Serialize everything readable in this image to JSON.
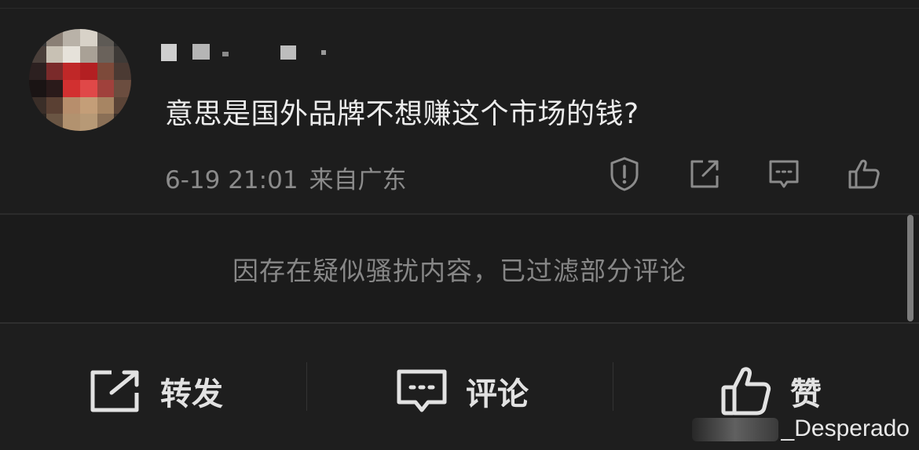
{
  "comment": {
    "text": "意思是国外品牌不想赚这个市场的钱?",
    "date": "6-19 21:01",
    "location": "来自广东"
  },
  "comment_actions": [
    {
      "icon": "report-icon"
    },
    {
      "icon": "share-icon"
    },
    {
      "icon": "comment-icon"
    },
    {
      "icon": "like-icon"
    }
  ],
  "filter_notice": "因存在疑似骚扰内容，已过滤部分评论",
  "bottom_bar": {
    "repost_label": "转发",
    "comment_label": "评论",
    "like_label": "赞"
  },
  "watermark": "_Desperado",
  "colors": {
    "background": "#1d1d1d",
    "text_primary": "#ececec",
    "text_secondary": "#8b8b8b"
  }
}
